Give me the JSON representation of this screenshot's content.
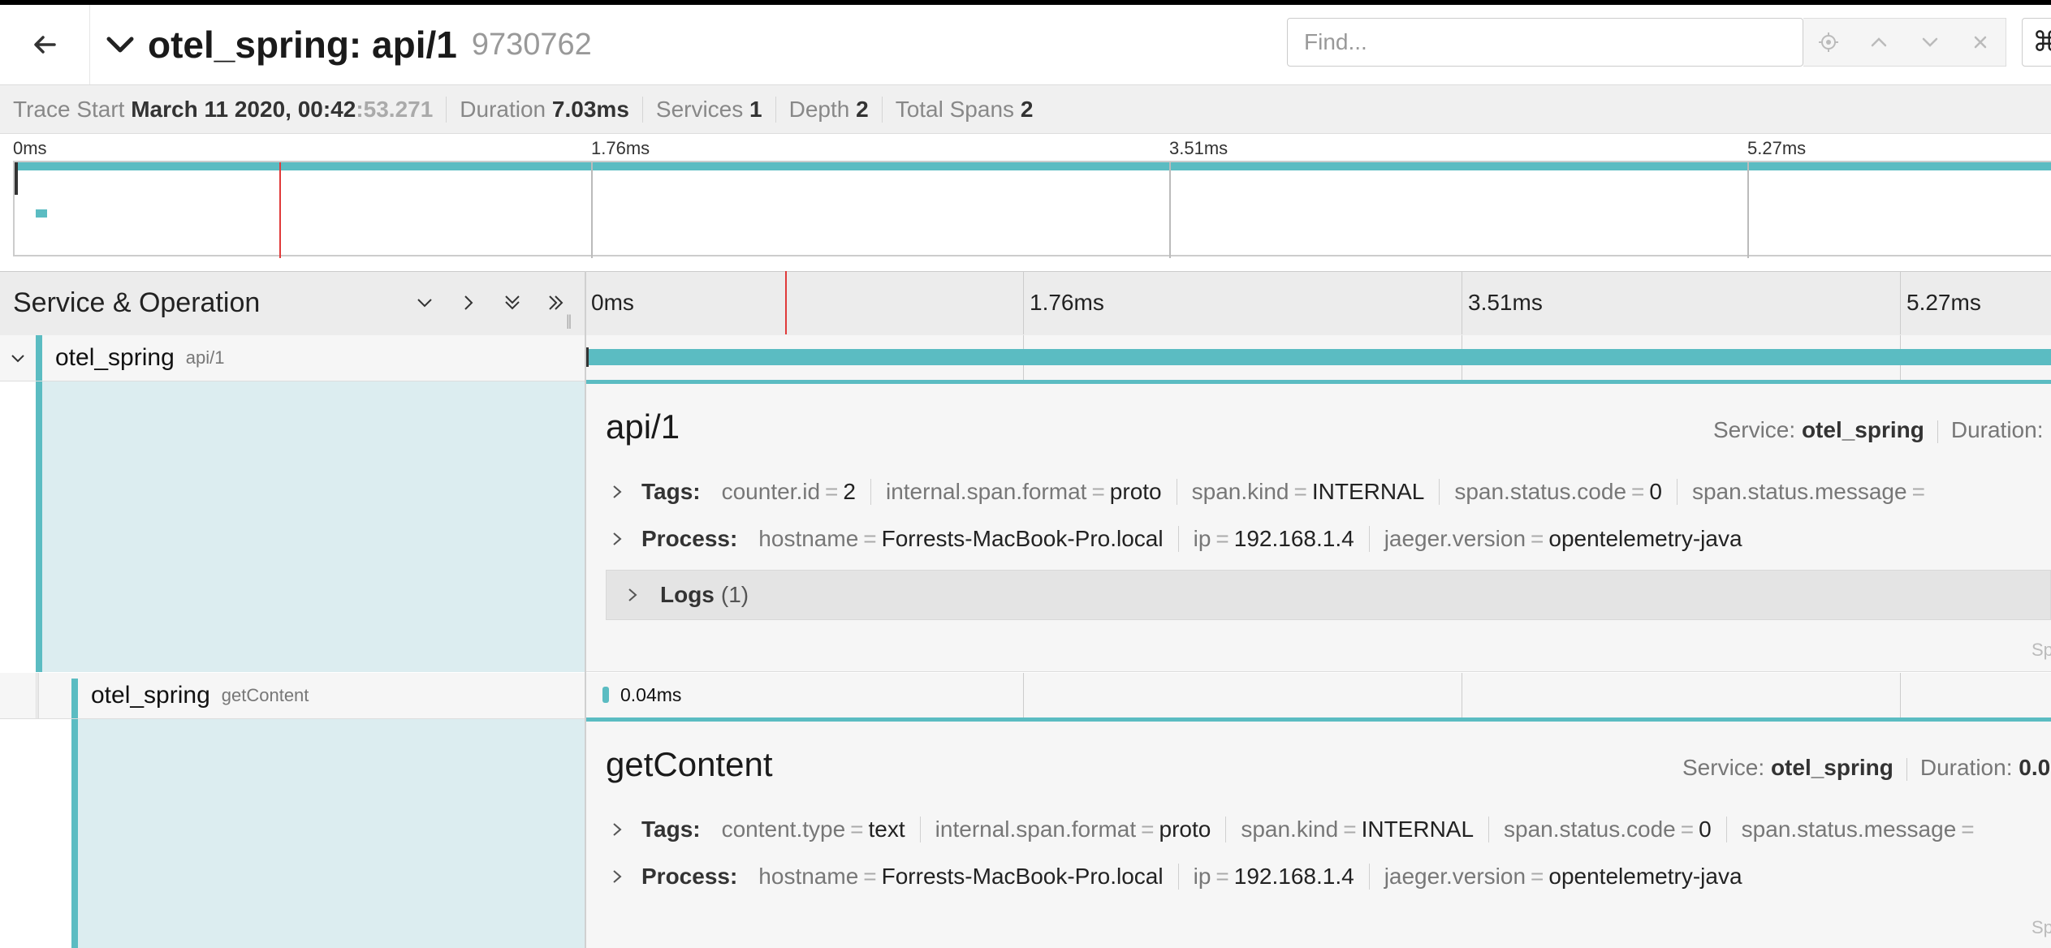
{
  "header": {
    "back_icon": "arrow-left-icon",
    "collapse_icon": "chevron-down-icon",
    "title": "otel_spring: api/1",
    "trace_id": "9730762",
    "find_placeholder": "Find...",
    "kbd_glyph": "⌘"
  },
  "summary": {
    "trace_start_label": "Trace Start",
    "trace_start_value": "March 11 2020, 00:42",
    "trace_start_ms": ":53.271",
    "duration_label": "Duration",
    "duration_value": "7.03ms",
    "services_label": "Services",
    "services_value": "1",
    "depth_label": "Depth",
    "depth_value": "2",
    "total_spans_label": "Total Spans",
    "total_spans_value": "2"
  },
  "minimap": {
    "ticks": [
      "0ms",
      "1.76ms",
      "3.51ms",
      "5.27ms"
    ]
  },
  "timeline": {
    "header_title": "Service & Operation",
    "ticks": [
      "0ms",
      "1.76ms",
      "3.51ms",
      "5.27ms"
    ]
  },
  "spans": [
    {
      "service": "otel_spring",
      "operation": "api/1",
      "detail": {
        "title": "api/1",
        "service_label": "Service:",
        "service_value": "otel_spring",
        "duration_label": "Duration:",
        "tags_label": "Tags:",
        "tags": [
          {
            "k": "counter.id",
            "v": "2"
          },
          {
            "k": "internal.span.format",
            "v": "proto"
          },
          {
            "k": "span.kind",
            "v": "INTERNAL"
          },
          {
            "k": "span.status.code",
            "v": "0"
          },
          {
            "k": "span.status.message",
            "v": ""
          }
        ],
        "process_label": "Process:",
        "process": [
          {
            "k": "hostname",
            "v": "Forrests-MacBook-Pro.local"
          },
          {
            "k": "ip",
            "v": "192.168.1.4"
          },
          {
            "k": "jaeger.version",
            "v": "opentelemetry-java"
          }
        ],
        "logs_label": "Logs",
        "logs_count": "(1)",
        "corner_cut": "Sp"
      }
    },
    {
      "service": "otel_spring",
      "operation": "getContent",
      "bar_label": "0.04ms",
      "detail": {
        "title": "getContent",
        "service_label": "Service:",
        "service_value": "otel_spring",
        "duration_label": "Duration:",
        "duration_cut": "0.0",
        "tags_label": "Tags:",
        "tags": [
          {
            "k": "content.type",
            "v": "text"
          },
          {
            "k": "internal.span.format",
            "v": "proto"
          },
          {
            "k": "span.kind",
            "v": "INTERNAL"
          },
          {
            "k": "span.status.code",
            "v": "0"
          },
          {
            "k": "span.status.message",
            "v": ""
          }
        ],
        "process_label": "Process:",
        "process": [
          {
            "k": "hostname",
            "v": "Forrests-MacBook-Pro.local"
          },
          {
            "k": "ip",
            "v": "192.168.1.4"
          },
          {
            "k": "jaeger.version",
            "v": "opentelemetry-java"
          }
        ],
        "corner_cut": "Sp"
      }
    }
  ],
  "colors": {
    "span": "#5bbcc2",
    "detail_bg": "#dcedf0",
    "marker": "#e03a3a"
  }
}
